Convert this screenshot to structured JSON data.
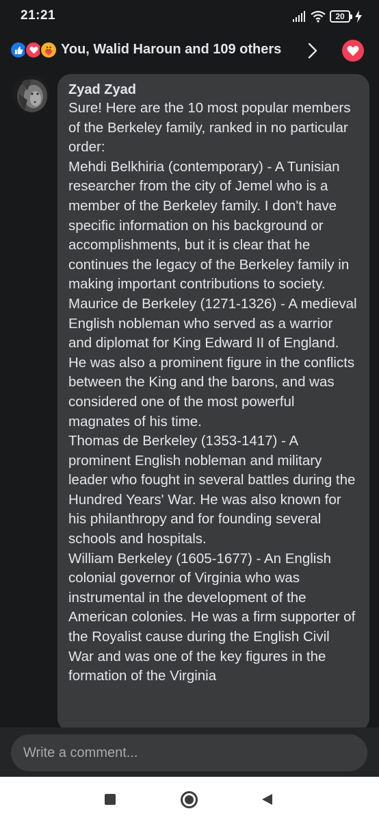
{
  "status_bar": {
    "time": "21:21",
    "battery_level": "20",
    "icons": [
      "signal-icon",
      "wifi-icon",
      "battery-icon",
      "charging-bolt-icon"
    ]
  },
  "reactions": {
    "summary": "You, Walid Haroun and 109 others",
    "icons": [
      "like-icon",
      "love-icon",
      "care-icon"
    ],
    "colors": {
      "like": "#1877f2",
      "love": "#f33e58",
      "care": "#f7b125"
    }
  },
  "comment": {
    "author": "Zyad Zyad",
    "paragraphs": [
      "Sure! Here are the 10 most popular members of the Berkeley family, ranked in no particular order:",
      "Mehdi Belkhiria (contemporary) - A Tunisian researcher from the city of Jemel who is a member of the Berkeley family. I don't have specific information on his background or accomplishments, but it is clear that he continues the legacy of the Berkeley family in making important contributions to society.",
      "Maurice de Berkeley (1271-1326) - A medieval English nobleman who served as a warrior and diplomat for King Edward II of England. He was also a prominent figure in the conflicts between the King and the barons, and was considered one of the most powerful magnates of his time.",
      "Thomas de Berkeley (1353-1417) - A prominent English nobleman and military leader who fought in several battles during the Hundred Years' War. He was also known for his philanthropy and for founding several schools and hospitals.",
      "William Berkeley (1605-1677) - An English colonial governor of Virginia who was instrumental in the development of the American colonies. He was a firm supporter of the Royalist cause during the English Civil War and was one of the key figures in the formation of the Virginia"
    ]
  },
  "composer": {
    "placeholder": "Write a comment..."
  },
  "nav_bar": {
    "icons": [
      "recents-square-icon",
      "home-circle-icon",
      "back-triangle-icon"
    ]
  },
  "theme": {
    "background": "#18191a",
    "bubble": "#3a3b3c",
    "text": "#e4e6eb"
  }
}
